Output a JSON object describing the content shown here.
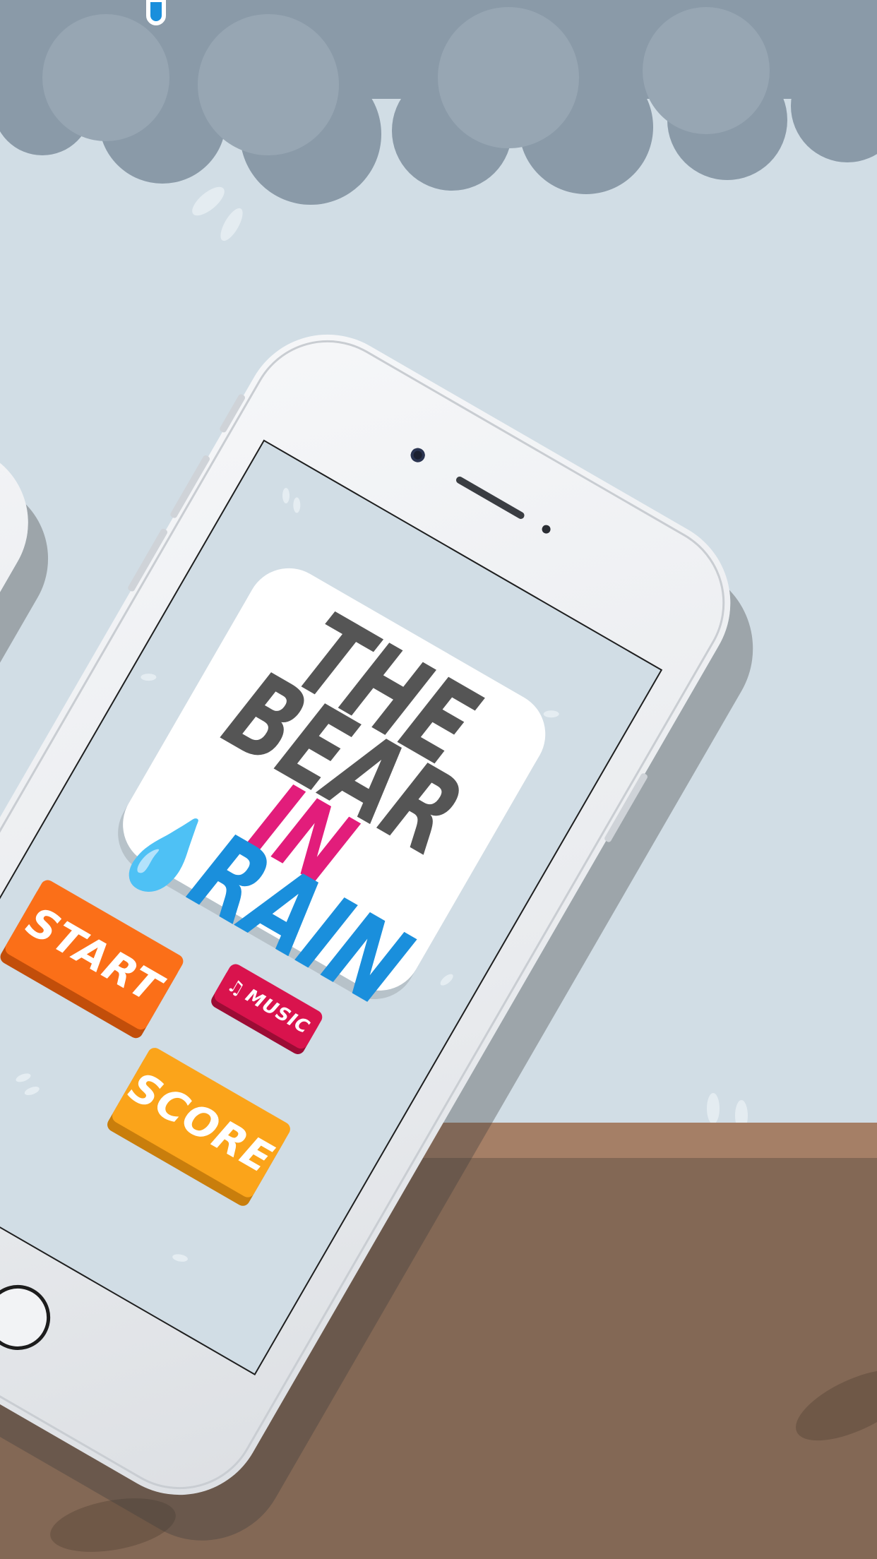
{
  "app": {
    "title_line1": "THE",
    "title_line2": "BEAR",
    "title_line3": "IN",
    "title_line4": "RAIN"
  },
  "menu": {
    "start_label": "START",
    "music_label": "MUSIC",
    "score_label": "SCORE"
  },
  "icons": {
    "music": "music-note-icon",
    "raindrop": "raindrop-icon"
  },
  "colors": {
    "sky": "#d1dde5",
    "cloud": "#8a9aa8",
    "ground": "#836855",
    "title_gray": "#555555",
    "title_pink": "#e21d7b",
    "title_blue": "#1a8fdc",
    "start_orange": "#fb6f18",
    "music_red": "#d9134d",
    "score_yellow": "#fba41a"
  }
}
